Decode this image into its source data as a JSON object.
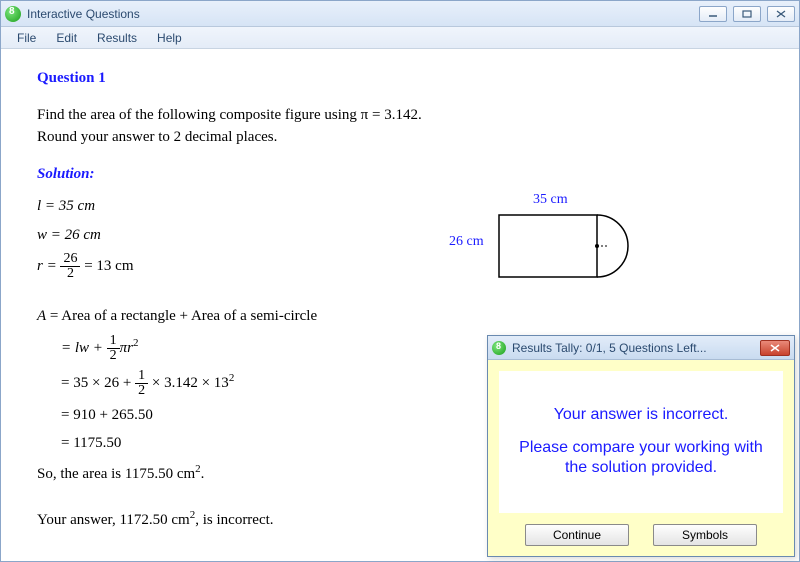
{
  "window": {
    "title": "Interactive Questions"
  },
  "menu": {
    "file": "File",
    "edit": "Edit",
    "results": "Results",
    "help": "Help"
  },
  "question": {
    "heading": "Question 1",
    "prompt_line1": "Find the area of the following composite figure using π = 3.142.",
    "prompt_line2": "Round your answer to 2 decimal places."
  },
  "solution": {
    "label": "Solution:",
    "l_line": "l = 35 cm",
    "w_line": "w = 26 cm",
    "r_prefix": "r = ",
    "r_frac_n": "26",
    "r_frac_d": "2",
    "r_suffix": " = 13 cm",
    "a_line": "A = Area of a rectangle + Area of a semi-circle",
    "step1_prefix": "= lw + ",
    "step1_frac_n": "1",
    "step1_frac_d": "2",
    "step1_suffix1": "πr",
    "step1_exp": "2",
    "step2_prefix": "= 35 × 26 + ",
    "step2_frac_n": "1",
    "step2_frac_d": "2",
    "step2_mid": " × 3.142 × 13",
    "step2_exp": "2",
    "step3": "= 910 + 265.50",
    "step4": "= 1175.50",
    "so_prefix": "So, the area is 1175.50 cm",
    "so_exp": "2",
    "so_suffix": ".",
    "your_prefix": "Your answer, 1172.50 cm",
    "your_exp": "2",
    "your_suffix": ", is incorrect."
  },
  "figure": {
    "width_label": "35 cm",
    "height_label": "26 cm"
  },
  "dialog": {
    "title": "Results Tally:  0/1, 5 Questions Left...",
    "msg1": "Your answer is incorrect.",
    "msg2": "Please compare your working with the solution provided.",
    "continue": "Continue",
    "symbols": "Symbols"
  }
}
